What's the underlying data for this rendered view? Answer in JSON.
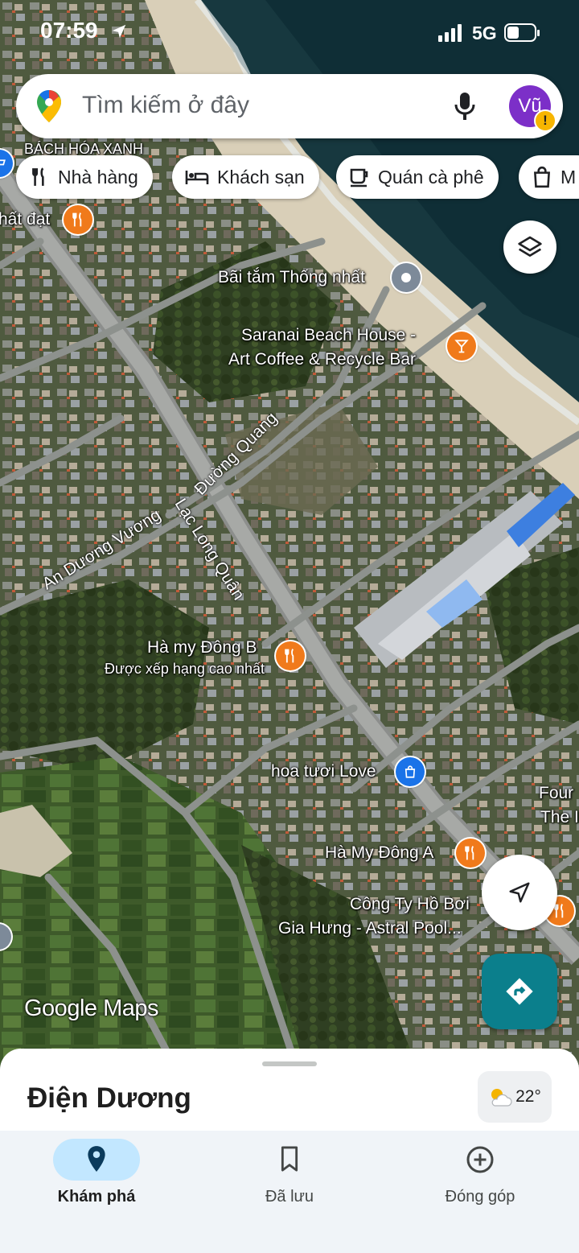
{
  "status_bar": {
    "time": "07:59",
    "network": "5G"
  },
  "search": {
    "placeholder": "Tìm kiếm ở đây",
    "avatar_initial": "Vũ",
    "warning_mark": "!"
  },
  "chips": [
    {
      "label": "Nhà hàng",
      "icon": "restaurant-icon"
    },
    {
      "label": "Khách sạn",
      "icon": "hotel-icon"
    },
    {
      "label": "Quán cà phê",
      "icon": "coffee-icon"
    },
    {
      "label": "M",
      "icon": "shopping-icon"
    }
  ],
  "map": {
    "labels": {
      "bach_hoa": "BÁCH HÓA XANH",
      "nhat_dat": "hất đạt",
      "bai_tam": "Bãi tắm Thống nhất",
      "saranai_1": "Saranai Beach House -",
      "saranai_2": "Art Coffee & Recycle Bar",
      "hamy_b": "Hà my Đông B",
      "hamy_b_sub": "Được xếp hạng cao nhất",
      "hoa_tuoi": "hoa tươi Love",
      "hamy_a": "Hà My Đông A",
      "cong_ty_1": "Công Ty Hồ Bơi",
      "cong_ty_2": "Gia Hưng - Astral Pool...",
      "four_1": "Four",
      "four_2": "The I"
    },
    "roads": {
      "duong_quang": "Đường Quang",
      "lac_long_quan": "Lạc Long Quân",
      "an_duong_vuong": "An Dương Vương"
    },
    "watermark": "Google Maps"
  },
  "sheet": {
    "place": "Điện Dương",
    "temperature": "22°"
  },
  "bottom_nav": [
    {
      "label": "Khám phá",
      "icon": "explore-pin-icon",
      "active": true
    },
    {
      "label": "Đã lưu",
      "icon": "bookmark-icon",
      "active": false
    },
    {
      "label": "Đóng góp",
      "icon": "add-circle-icon",
      "active": false
    }
  ],
  "colors": {
    "accent_teal": "#0b7f8c",
    "pill_blue": "#c2e7ff",
    "avatar_purple": "#7c2fc8",
    "pin_orange": "#f07a1b"
  }
}
